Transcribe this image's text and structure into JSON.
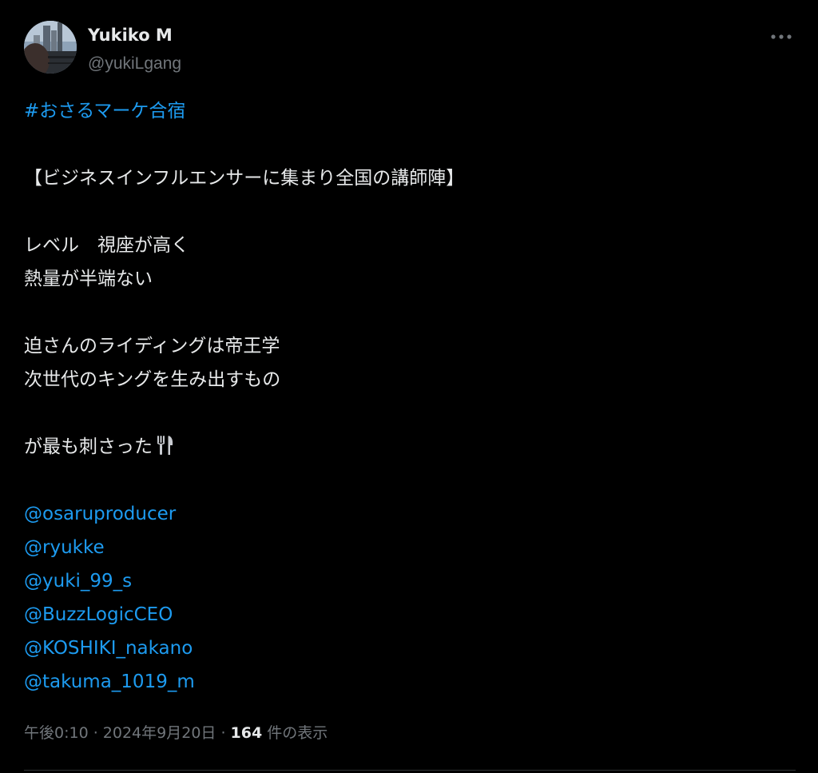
{
  "author": {
    "display_name": "Yukiko M",
    "handle": "@yukiLgang",
    "avatar_icon": "profile-photo"
  },
  "more_icon": "more-horizontal-icon",
  "tweet": {
    "hashtag": "#おさるマーケ合宿",
    "heading": "【ビジネスインフルエンサーに集まり全国の講師陣】",
    "line1": "レベル　視座が高く",
    "line2": "熱量が半端ない",
    "line3": "迫さんのライディングは帝王学",
    "line4": "次世代のキングを生み出すもの",
    "line5": "が最も刺さった",
    "line5_icon": "fork-and-knife-icon",
    "mentions": [
      "@osaruproducer",
      "@ryukke",
      "@yuki_99_s",
      "@BuzzLogicCEO",
      "@KOSHIKI_nakano",
      "@takuma_1019_m"
    ]
  },
  "meta": {
    "time": "午後0:10",
    "separator1": " · ",
    "date": "2024年9月20日",
    "separator2": " · ",
    "views_count": "164",
    "views_label": " 件の表示"
  },
  "colors": {
    "background": "#000000",
    "text": "#e7e9ea",
    "secondary": "#71767b",
    "link": "#1d9bf0"
  }
}
